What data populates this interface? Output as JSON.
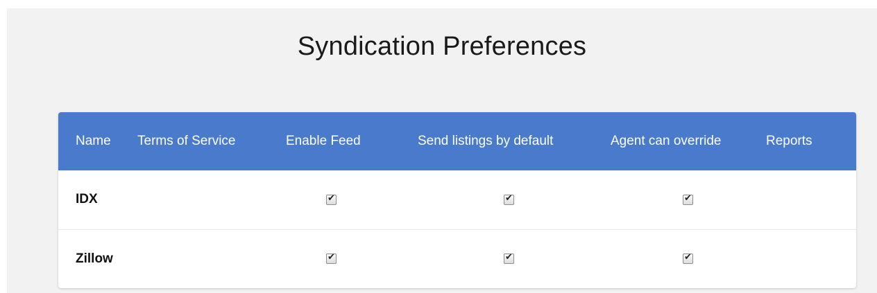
{
  "page": {
    "title": "Syndication Preferences"
  },
  "table": {
    "columns": [
      "Name",
      "Terms of Service",
      "Enable Feed",
      "Send listings by default",
      "Agent can override",
      "Reports"
    ],
    "rows": [
      {
        "name": "IDX",
        "terms_of_service": "",
        "enable_feed": true,
        "send_listings_by_default": true,
        "agent_can_override": true,
        "reports": ""
      },
      {
        "name": "Zillow",
        "terms_of_service": "",
        "enable_feed": true,
        "send_listings_by_default": true,
        "agent_can_override": true,
        "reports": ""
      }
    ]
  },
  "colors": {
    "header_bg": "#4a7acb",
    "page_bg": "#f2f2f2"
  },
  "icons": {
    "checkbox_checked": "checkmark-icon"
  }
}
